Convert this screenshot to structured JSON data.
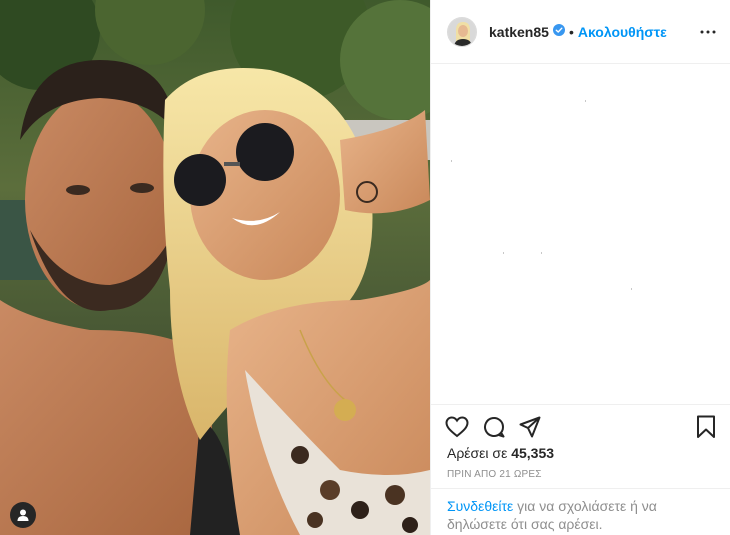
{
  "post": {
    "photo_icon": "photo-of-couple",
    "user_tag_icon": "person-tag-icon"
  },
  "header": {
    "username": "katken85",
    "verified_icon": "verified-badge-icon",
    "separator": "•",
    "follow_label": "Ακολουθήστε",
    "more_icon": "more-options-icon"
  },
  "actions": {
    "like_icon": "heart-icon",
    "comment_icon": "comment-icon",
    "share_icon": "share-icon",
    "save_icon": "bookmark-icon"
  },
  "likes": {
    "prefix": "Αρέσει σε ",
    "count": "45,353"
  },
  "timestamp": "ΠΡΙΝ ΑΠΟ 21 ΩΡΕΣ",
  "login_prompt": {
    "link": "Συνδεθείτε",
    "text": " για να σχολιάσετε ή να δηλώσετε ότι σας αρέσει."
  },
  "colors": {
    "accent": "#0095f6",
    "text": "#262626",
    "muted": "#8e8e8e",
    "border": "#efefef"
  }
}
